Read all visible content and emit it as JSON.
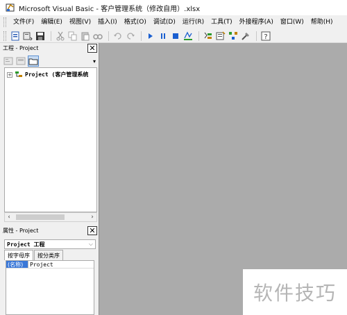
{
  "window": {
    "title": "Microsoft Visual Basic - 客户管理系统（修改自用）.xlsx"
  },
  "menu": {
    "items": [
      {
        "label": "文件(F)"
      },
      {
        "label": "编辑(E)"
      },
      {
        "label": "视图(V)"
      },
      {
        "label": "插入(I)"
      },
      {
        "label": "格式(O)"
      },
      {
        "label": "调试(D)"
      },
      {
        "label": "运行(R)"
      },
      {
        "label": "工具(T)"
      },
      {
        "label": "外接程序(A)"
      },
      {
        "label": "窗口(W)"
      },
      {
        "label": "帮助(H)"
      }
    ]
  },
  "toolbar": {
    "icons": [
      "view-excel-icon",
      "insert-module-icon",
      "save-icon",
      "cut-icon",
      "copy-icon",
      "paste-icon",
      "find-icon",
      "undo-icon",
      "redo-icon",
      "run-icon",
      "break-icon",
      "reset-icon",
      "design-mode-icon",
      "project-explorer-icon",
      "properties-window-icon",
      "object-browser-icon",
      "toolbox-icon",
      "help-icon"
    ]
  },
  "project_pane": {
    "title": "工程 - Project",
    "tree": [
      {
        "label": "Project (客户管理系统"
      }
    ]
  },
  "properties_pane": {
    "title": "属性 - Project",
    "object_combo": "Project 工程",
    "tabs": [
      "按字母序",
      "按分类序"
    ],
    "rows": [
      {
        "name": "(名称)",
        "value": "Project"
      }
    ]
  },
  "watermark": {
    "text": "软件技巧"
  },
  "colors": {
    "workspace": "#ababab",
    "chrome": "#f0f0f0",
    "selection": "#3a78d8"
  }
}
